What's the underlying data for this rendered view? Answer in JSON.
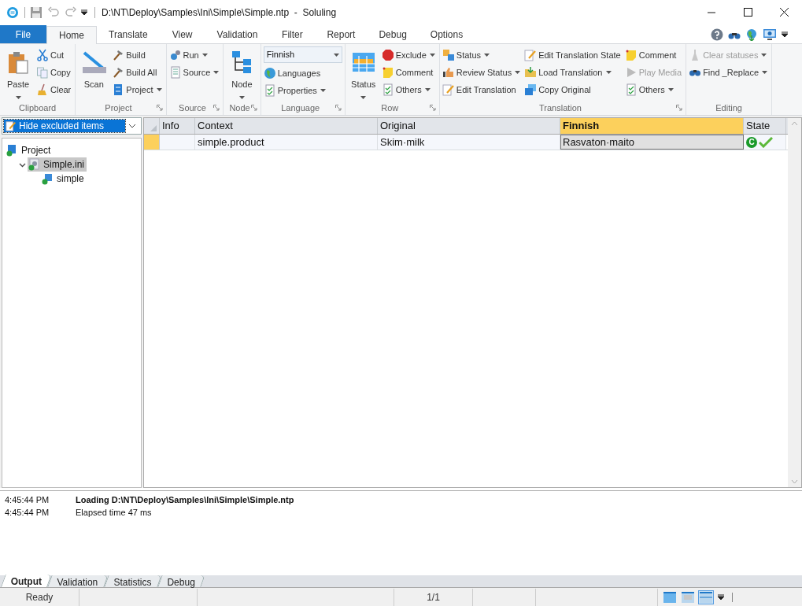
{
  "window": {
    "title": "D:\\NT\\Deploy\\Samples\\Ini\\Simple\\Simple.ntp  -  Soluling"
  },
  "ribbon": {
    "file_tab": "File",
    "tabs": [
      {
        "label": "Home",
        "selected": true
      },
      {
        "label": "Translate",
        "selected": false
      },
      {
        "label": "View",
        "selected": false
      },
      {
        "label": "Validation",
        "selected": false
      },
      {
        "label": "Filter",
        "selected": false
      },
      {
        "label": "Report",
        "selected": false
      },
      {
        "label": "Debug",
        "selected": false
      },
      {
        "label": "Options",
        "selected": false
      }
    ],
    "groups": [
      {
        "label": "Clipboard",
        "launcher": false,
        "columns": [
          [
            {
              "kind": "large",
              "label": "Paste",
              "dropdown": true
            }
          ],
          [
            {
              "kind": "small",
              "label": "Cut"
            },
            {
              "kind": "small",
              "label": "Copy"
            },
            {
              "kind": "small",
              "label": "Clear"
            }
          ]
        ]
      },
      {
        "label": "Project",
        "launcher": true,
        "columns": [
          [
            {
              "kind": "large",
              "label": "Scan",
              "dropdown": false
            }
          ],
          [
            {
              "kind": "small",
              "label": "Build"
            },
            {
              "kind": "small",
              "label": "Build All"
            },
            {
              "kind": "small",
              "label": "Project",
              "dropdown": true
            }
          ]
        ]
      },
      {
        "label": "Source",
        "launcher": true,
        "columns": [
          [
            {
              "kind": "small",
              "label": "Run",
              "dropdown": true
            },
            {
              "kind": "small",
              "label": "Source",
              "dropdown": true
            }
          ]
        ]
      },
      {
        "label": "Node",
        "launcher": true,
        "columns": [
          [
            {
              "kind": "large",
              "label": "Node",
              "dropdown": true
            }
          ]
        ]
      },
      {
        "label": "Language",
        "launcher": true,
        "columns": [
          [
            {
              "kind": "combo",
              "label": "Finnish"
            },
            {
              "kind": "small",
              "label": "Languages"
            },
            {
              "kind": "small",
              "label": "Properties",
              "dropdown": true
            }
          ]
        ]
      },
      {
        "label": "Row",
        "launcher": true,
        "columns": [
          [
            {
              "kind": "large",
              "label": "Status",
              "dropdown": true
            }
          ],
          [
            {
              "kind": "small",
              "label": "Exclude",
              "dropdown": true
            },
            {
              "kind": "small",
              "label": "Comment"
            },
            {
              "kind": "small",
              "label": "Others",
              "dropdown": true
            }
          ]
        ]
      },
      {
        "label": "Translation",
        "launcher": true,
        "columns": [
          [
            {
              "kind": "small",
              "label": "Status",
              "dropdown": true
            },
            {
              "kind": "small",
              "label": "Review Status",
              "dropdown": true
            },
            {
              "kind": "small",
              "label": "Edit Translation"
            }
          ],
          [
            {
              "kind": "small",
              "label": "Edit Translation State"
            },
            {
              "kind": "small",
              "label": "Load Translation",
              "dropdown": true
            },
            {
              "kind": "small",
              "label": "Copy Original"
            }
          ],
          [
            {
              "kind": "small",
              "label": "Comment"
            },
            {
              "kind": "small",
              "label": "Play Media",
              "disabled": true
            },
            {
              "kind": "small",
              "label": "Others",
              "dropdown": true
            }
          ]
        ]
      },
      {
        "label": "Editing",
        "launcher": false,
        "columns": [
          [
            {
              "kind": "small",
              "label": "Clear statuses",
              "dropdown": true,
              "disabled": true
            },
            {
              "kind": "small",
              "label": "Find _Replace",
              "dropdown": true
            }
          ]
        ]
      }
    ]
  },
  "filter": {
    "value": "Hide excluded items"
  },
  "tree": [
    {
      "label": "Project",
      "selected": false,
      "children": [
        {
          "label": "Simple.ini",
          "expanded": true,
          "selected": true,
          "children": [
            {
              "label": "simple",
              "selected": false
            }
          ]
        }
      ]
    }
  ],
  "grid": {
    "columns": [
      {
        "label": "Info",
        "highlighted": false
      },
      {
        "label": "Context",
        "highlighted": false
      },
      {
        "label": "Original",
        "highlighted": false
      },
      {
        "label": "Finnish",
        "highlighted": true
      },
      {
        "label": "State",
        "highlighted": false
      }
    ],
    "rows": [
      {
        "selected": true,
        "info": "",
        "context": "simple.product",
        "original": "Skim·milk",
        "translation": "Rasvaton·maito",
        "state_badge": "C",
        "translated": true
      }
    ]
  },
  "output": {
    "lines": [
      {
        "time": "4:45:44 PM",
        "message": "Loading D:\\NT\\Deploy\\Samples\\Ini\\Simple\\Simple.ntp",
        "bold": true
      },
      {
        "time": "4:45:44 PM",
        "message": "Elapsed time 47 ms",
        "bold": false
      }
    ],
    "tabs": [
      {
        "label": "Output",
        "selected": true
      },
      {
        "label": "Validation",
        "selected": false
      },
      {
        "label": "Statistics",
        "selected": false
      },
      {
        "label": "Debug",
        "selected": false
      }
    ]
  },
  "status_bar": {
    "status": "Ready",
    "position": "1/1",
    "views": [
      {
        "selected": false
      },
      {
        "selected": false
      },
      {
        "selected": true
      }
    ]
  }
}
